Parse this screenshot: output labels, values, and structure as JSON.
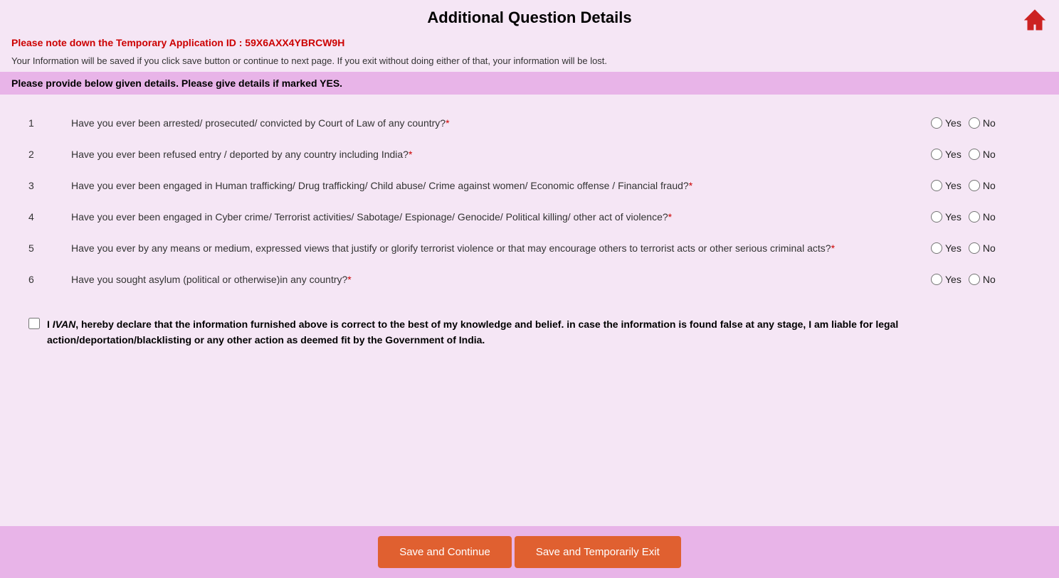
{
  "header": {
    "title": "Additional Question Details",
    "home_icon": "home-icon"
  },
  "temp_id_label": "Please note down the Temporary Application ID :",
  "temp_id_value": "59X6AXX4YBRCW9H",
  "info_text": "Your Information will be saved if you click save button or continue to next page. If you exit without doing either of that, your information will be lost.",
  "notice": "Please provide below given details. Please give details if marked YES.",
  "questions": [
    {
      "num": "1",
      "text": "Have you ever been arrested/ prosecuted/ convicted by Court of Law of any country?",
      "required": true
    },
    {
      "num": "2",
      "text": "Have you ever been refused entry / deported by any country including India?",
      "required": true
    },
    {
      "num": "3",
      "text": "Have you ever been engaged in Human trafficking/ Drug trafficking/ Child abuse/ Crime against women/ Economic offense / Financial fraud?",
      "required": true
    },
    {
      "num": "4",
      "text": "Have you ever been engaged in Cyber crime/ Terrorist activities/ Sabotage/ Espionage/ Genocide/ Political killing/ other act of violence?",
      "required": true
    },
    {
      "num": "5",
      "text": "Have you ever by any means or medium, expressed views that justify or glorify terrorist violence or that may encourage others to terrorist acts or other serious criminal acts?",
      "required": true
    },
    {
      "num": "6",
      "text": "Have you sought asylum (political or otherwise)in any country?",
      "required": true
    }
  ],
  "radio_yes_label": "Yes",
  "radio_no_label": "No",
  "declaration_name": "IVAN",
  "declaration_text_part1": "I ",
  "declaration_text_part2": ", hereby declare that the information furnished above is correct to the best of my knowledge and belief. in case the information is found false at any stage, I am liable for legal action/deportation/blacklisting or any other action as deemed fit by the Government of India.",
  "buttons": {
    "save_continue": "Save and Continue",
    "save_exit": "Save and Temporarily Exit"
  }
}
